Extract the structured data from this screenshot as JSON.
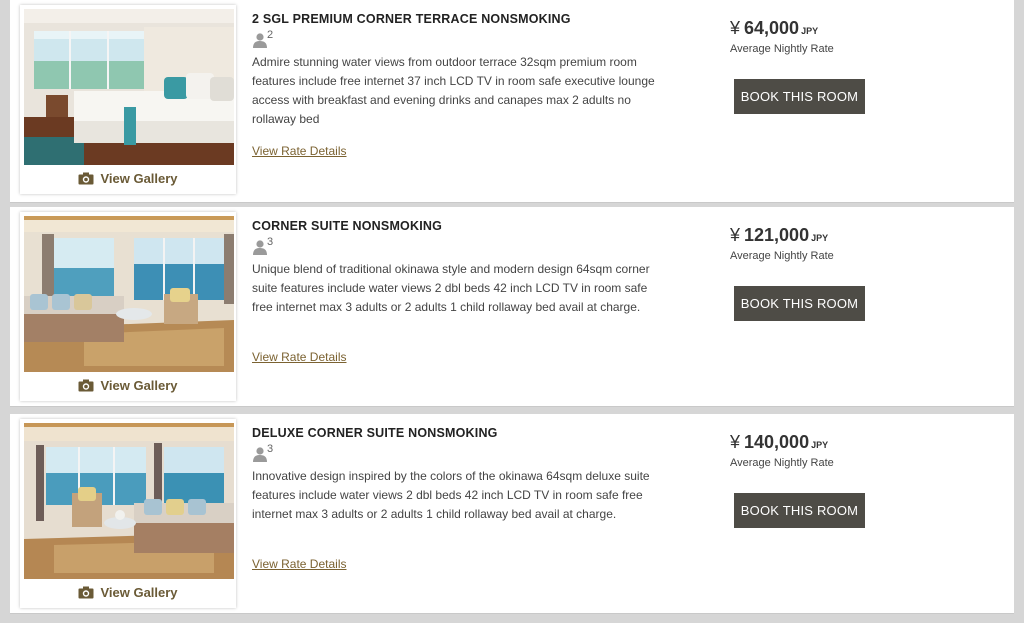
{
  "rooms": [
    {
      "name": "2 SGL PREMIUM CORNER TERRACE NONSMOKING",
      "occupancy": "2",
      "description": "Admire stunning water views from outdoor terrace 32sqm premium room features include free internet 37 inch LCD TV in room safe executive lounge access with breakfast and evening drinks and canapes max 2 adults no rollaway bed",
      "rate_link": "View Rate Details",
      "gallery": "View Gallery",
      "currency_symbol": "¥",
      "price": "64,000",
      "currency": "JPY",
      "price_label": "Average Nightly Rate",
      "book_label": "BOOK THIS ROOM"
    },
    {
      "name": "CORNER SUITE NONSMOKING",
      "occupancy": "3",
      "description": "Unique blend of traditional okinawa style and modern design 64sqm corner suite features include water views 2 dbl beds 42 inch LCD TV in room safe free internet max 3 adults or 2 adults 1 child rollaway bed avail at charge.",
      "rate_link": "View Rate Details",
      "gallery": "View Gallery",
      "currency_symbol": "¥",
      "price": "121,000",
      "currency": "JPY",
      "price_label": "Average Nightly Rate",
      "book_label": "BOOK THIS ROOM"
    },
    {
      "name": "DELUXE CORNER SUITE NONSMOKING",
      "occupancy": "3",
      "description": "Innovative design inspired by the colors of the okinawa 64sqm deluxe suite features include water views 2 dbl beds 42 inch LCD TV in room safe free internet max 3 adults or 2 adults 1 child rollaway bed avail at charge.",
      "rate_link": "View Rate Details",
      "gallery": "View Gallery",
      "currency_symbol": "¥",
      "price": "140,000",
      "currency": "JPY",
      "price_label": "Average Nightly Rate",
      "book_label": "BOOK THIS ROOM"
    }
  ],
  "colors": {
    "button_bg": "#4e4c46",
    "link": "#7b6231",
    "gallery_text": "#6a5a36"
  }
}
